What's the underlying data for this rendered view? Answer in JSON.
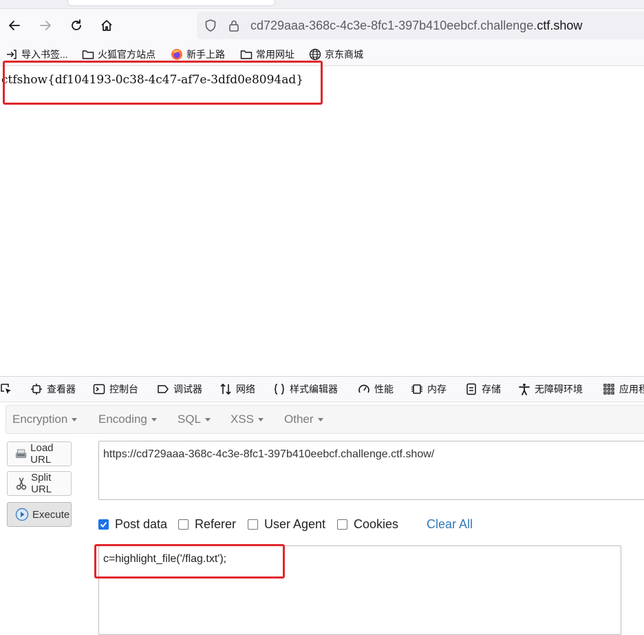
{
  "browser": {
    "url_prefix": "cd729aaa-368c-4c3e-8fc1-397b410eebcf.challenge.",
    "url_domain": "ctf.show",
    "bookmarks": [
      {
        "label": "导入书签...",
        "icon": "import-icon"
      },
      {
        "label": "火狐官方站点",
        "icon": "folder-icon"
      },
      {
        "label": "新手上路",
        "icon": "firefox-icon"
      },
      {
        "label": "常用网址",
        "icon": "folder-icon"
      },
      {
        "label": "京东商城",
        "icon": "globe-icon"
      }
    ]
  },
  "page": {
    "flag": "ctfshow{df104193-0c38-4c47-af7e-3dfd0e8094ad}"
  },
  "devtools": {
    "tabs": [
      {
        "label": "查看器",
        "icon": "inspector-icon"
      },
      {
        "label": "控制台",
        "icon": "console-icon"
      },
      {
        "label": "调试器",
        "icon": "debugger-icon"
      },
      {
        "label": "网络",
        "icon": "network-icon"
      },
      {
        "label": "样式编辑器",
        "icon": "style-editor-icon"
      },
      {
        "label": "性能",
        "icon": "performance-icon"
      },
      {
        "label": "内存",
        "icon": "memory-icon"
      },
      {
        "label": "存储",
        "icon": "storage-icon"
      },
      {
        "label": "无障碍环境",
        "icon": "accessibility-icon"
      },
      {
        "label": "应用程",
        "icon": "application-icon"
      }
    ]
  },
  "hackbar": {
    "menus": [
      "Encryption",
      "Encoding",
      "SQL",
      "XSS",
      "Other"
    ],
    "load_url": "Load URL",
    "split_url": "Split URL",
    "execute": "Execute",
    "url_value": "https://cd729aaa-368c-4c3e-8fc1-397b410eebcf.challenge.ctf.show/",
    "options": [
      {
        "label": "Post data",
        "checked": true
      },
      {
        "label": "Referer",
        "checked": false
      },
      {
        "label": "User Agent",
        "checked": false
      },
      {
        "label": "Cookies",
        "checked": false
      }
    ],
    "clear_all": "Clear All",
    "post_value": "c=highlight_file('/flag.txt');"
  },
  "colors": {
    "highlight_red": "#e0262b",
    "checkbox_blue": "#1a73e8",
    "link_blue": "#337ab7"
  }
}
